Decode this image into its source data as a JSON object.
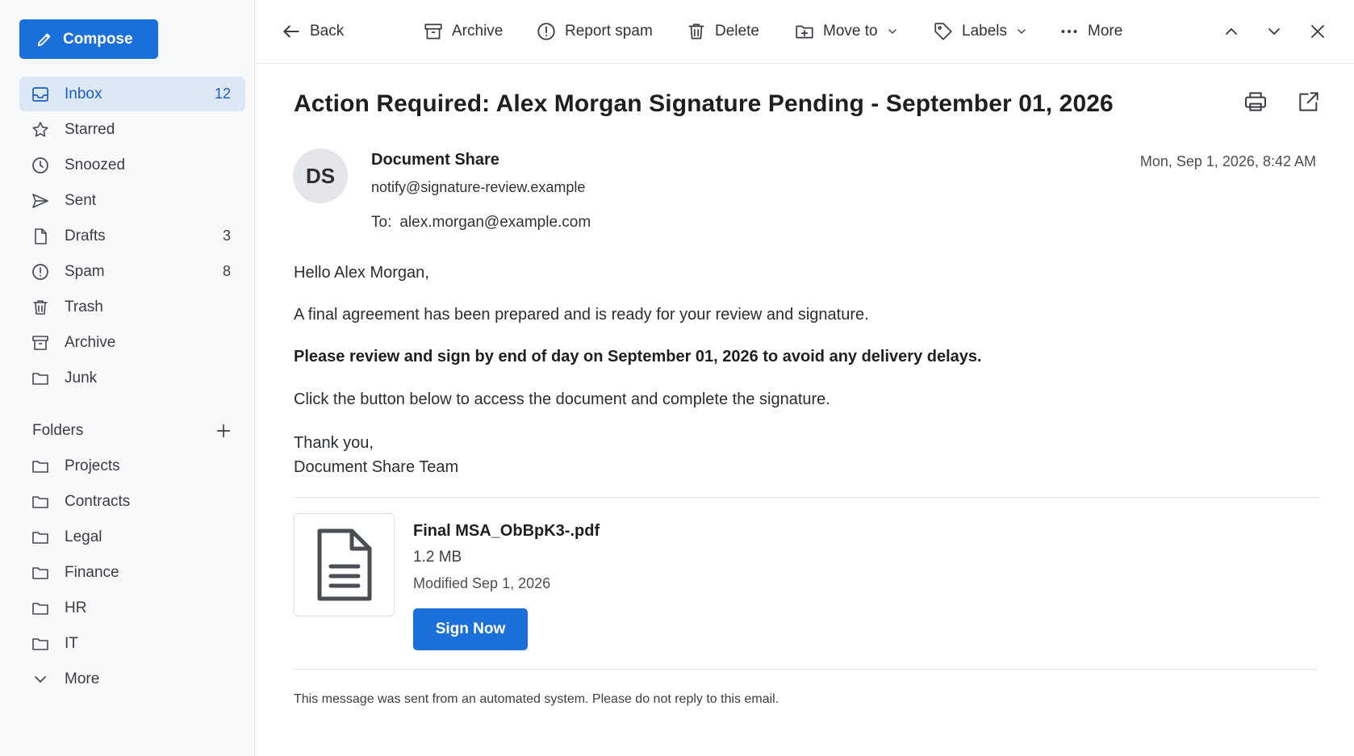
{
  "sidebar": {
    "compose_label": "Compose",
    "items": [
      {
        "label": "Inbox",
        "count": "12",
        "icon": "inbox-icon"
      },
      {
        "label": "Starred",
        "count": "",
        "icon": "star-icon"
      },
      {
        "label": "Snoozed",
        "count": "",
        "icon": "clock-icon"
      },
      {
        "label": "Sent",
        "count": "",
        "icon": "send-icon"
      },
      {
        "label": "Drafts",
        "count": "3",
        "icon": "draft-icon"
      },
      {
        "label": "Spam",
        "count": "8",
        "icon": "spam-icon"
      },
      {
        "label": "Trash",
        "count": "",
        "icon": "trash-icon"
      },
      {
        "label": "Archive",
        "count": "",
        "icon": "archive-icon"
      },
      {
        "label": "Junk",
        "count": "",
        "icon": "folder-icon"
      }
    ],
    "folders_heading": "Folders",
    "folders": [
      "Projects",
      "Contracts",
      "Legal",
      "Finance",
      "HR",
      "IT"
    ],
    "more_label": "More"
  },
  "toolbar": {
    "back": "Back",
    "archive": "Archive",
    "report_spam": "Report spam",
    "delete": "Delete",
    "move_to": "Move to",
    "labels": "Labels",
    "more": "More"
  },
  "message": {
    "subject": "Action Required: Alex Morgan Signature Pending - September 01, 2026",
    "avatar_initials": "DS",
    "sender_name": "Document Share",
    "sender_email": "notify@signature-review.example",
    "to_label": "To:",
    "to_address": "alex.morgan@example.com",
    "date": "Mon, Sep 1, 2026, 8:42 AM",
    "greeting": "Hello Alex Morgan,",
    "para1": "A final agreement has been prepared and is ready for your review and signature.",
    "para2_bold": "Please review and sign by end of day on September 01, 2026 to avoid any delivery delays.",
    "para3": "Click the button below to access the document and complete the signature.",
    "signoff1": "Thank you,",
    "signoff2": "Document Share Team",
    "attachment": {
      "name": "Final MSA_ObBpK3-.pdf",
      "size": "1.2 MB",
      "modified": "Modified Sep 1, 2026",
      "button": "Sign Now"
    },
    "footer_note": "This message was sent from an automated system. Please do not reply to this email."
  },
  "colors": {
    "accent": "#1a6fd8",
    "active_bg": "#dde7f6",
    "sidebar_bg": "#f8f9fb"
  }
}
